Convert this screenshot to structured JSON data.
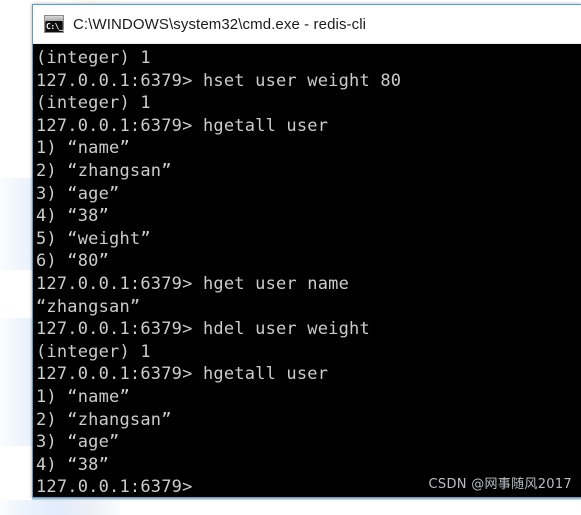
{
  "window": {
    "title": "C:\\WINDOWS\\system32\\cmd.exe - redis-cli",
    "icon_name": "cmd-icon",
    "icon_glyph": "C:\\_",
    "background_color": "#000000",
    "titlebar_color": "#ffffff",
    "border_color": "#5d9ec9"
  },
  "console": {
    "text_color": "#cccccc",
    "prompt": "127.0.0.1:6379>",
    "lines": [
      "(integer) 1",
      "127.0.0.1:6379> hset user weight 80",
      "(integer) 1",
      "127.0.0.1:6379> hgetall user",
      "1) “name”",
      "2) “zhangsan”",
      "3) “age”",
      "4) “38”",
      "5) “weight”",
      "6) “80”",
      "127.0.0.1:6379> hget user name",
      "“zhangsan”",
      "127.0.0.1:6379> hdel user weight",
      "(integer) 1",
      "127.0.0.1:6379> hgetall user",
      "1) “name”",
      "2) “zhangsan”",
      "3) “age”",
      "4) “38”",
      "127.0.0.1:6379>"
    ]
  },
  "watermark": {
    "text": "CSDN @网事随风2017",
    "color": "#b9bcc2"
  },
  "backdrop": {
    "page_color": "#ffffff",
    "band_color": "#e1ecfb"
  }
}
